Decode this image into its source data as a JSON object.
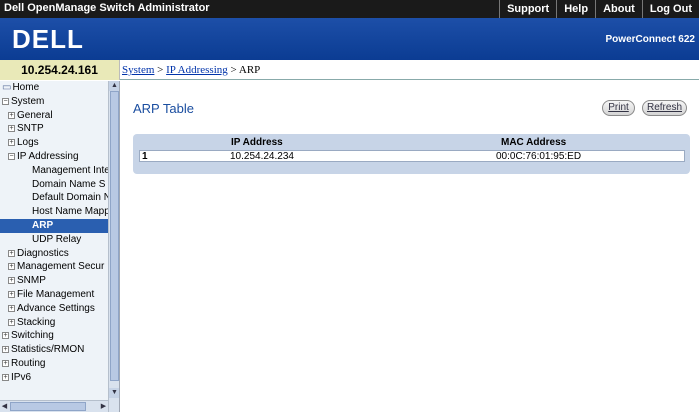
{
  "topbar": {
    "title": "Dell OpenManage Switch Administrator",
    "links": [
      "Support",
      "Help",
      "About",
      "Log Out"
    ]
  },
  "banner": {
    "logo": "DELL",
    "model": "PowerConnect 622"
  },
  "ip_address": "10.254.24.161",
  "breadcrumb": {
    "items": [
      "System",
      "IP Addressing",
      "ARP"
    ],
    "separator": ">"
  },
  "sidebar": {
    "items": [
      {
        "label": "Home",
        "level": 0,
        "expander": ""
      },
      {
        "label": "System",
        "level": 0,
        "expander": "-"
      },
      {
        "label": "General",
        "level": 1,
        "expander": "+"
      },
      {
        "label": "SNTP",
        "level": 1,
        "expander": "+"
      },
      {
        "label": "Logs",
        "level": 1,
        "expander": "+"
      },
      {
        "label": "IP Addressing",
        "level": 1,
        "expander": "-"
      },
      {
        "label": "Management Inte",
        "level": 3,
        "expander": ""
      },
      {
        "label": "Domain Name S",
        "level": 3,
        "expander": ""
      },
      {
        "label": "Default Domain N",
        "level": 3,
        "expander": ""
      },
      {
        "label": "Host Name Mapp",
        "level": 3,
        "expander": ""
      },
      {
        "label": "ARP",
        "level": 3,
        "expander": "",
        "selected": true
      },
      {
        "label": "UDP Relay",
        "level": 3,
        "expander": ""
      },
      {
        "label": "Diagnostics",
        "level": 1,
        "expander": "+"
      },
      {
        "label": "Management Secur",
        "level": 1,
        "expander": "+"
      },
      {
        "label": "SNMP",
        "level": 1,
        "expander": "+"
      },
      {
        "label": "File Management",
        "level": 1,
        "expander": "+"
      },
      {
        "label": "Advance Settings",
        "level": 1,
        "expander": "+"
      },
      {
        "label": "Stacking",
        "level": 1,
        "expander": "+"
      },
      {
        "label": "Switching",
        "level": 0,
        "expander": "+"
      },
      {
        "label": "Statistics/RMON",
        "level": 0,
        "expander": "+"
      },
      {
        "label": "Routing",
        "level": 0,
        "expander": "+"
      },
      {
        "label": "IPv6",
        "level": 0,
        "expander": "+"
      }
    ]
  },
  "main": {
    "title": "ARP Table",
    "buttons": {
      "print": "Print",
      "refresh": "Refresh"
    },
    "table": {
      "headers": [
        "IP Address",
        "MAC Address"
      ],
      "rows": [
        {
          "index": "1",
          "ip": "10.254.24.234",
          "mac": "00:0C:76:01:95:ED"
        }
      ]
    }
  },
  "colors": {
    "topbar": "#1a1a1a",
    "banner": "#0b3c93",
    "accent": "#1b4ea0",
    "selected": "#2a5fb0",
    "table_bg": "#c7d4e7"
  }
}
